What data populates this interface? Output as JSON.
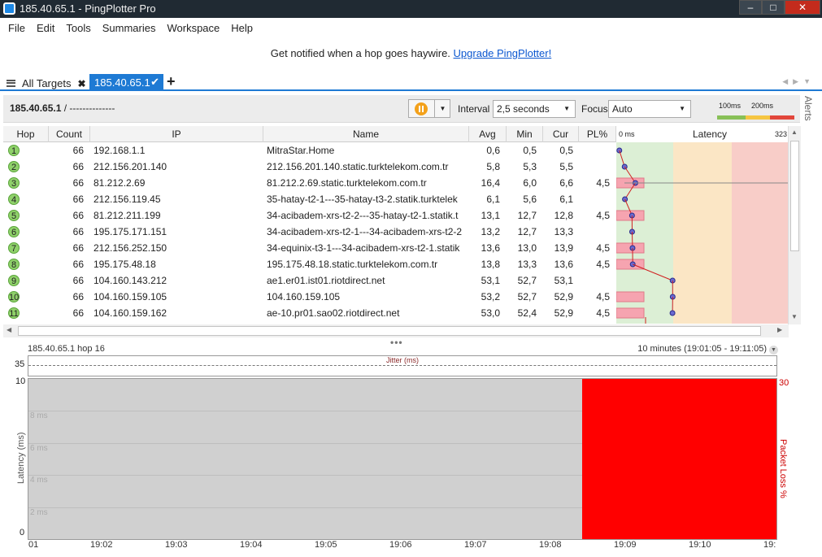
{
  "window": {
    "title": "185.40.65.1 - PingPlotter Pro"
  },
  "menu": [
    "File",
    "Edit",
    "Tools",
    "Summaries",
    "Workspace",
    "Help"
  ],
  "banner": {
    "text": "Get notified when a hop goes haywire.",
    "link": "Upgrade PingPlotter!"
  },
  "tabs": {
    "all": "All Targets",
    "active": "185.40.65.1"
  },
  "toolbar": {
    "target": "185.40.65.1",
    "target_suffix": "/ --------------",
    "interval_label": "Interval",
    "interval_value": "2,5 seconds",
    "focus_label": "Focus",
    "focus_value": "Auto",
    "legend": {
      "mark1": "100ms",
      "mark2": "200ms",
      "colors": [
        "#88c057",
        "#f5c542",
        "#e2463b"
      ]
    }
  },
  "alerts_label": "Alerts",
  "table": {
    "columns": [
      "Hop",
      "Count",
      "IP",
      "Name",
      "Avg",
      "Min",
      "Cur",
      "PL%",
      "0 ms",
      "Latency",
      "323"
    ],
    "rows": [
      {
        "hop": "1",
        "count": "66",
        "ip": "192.168.1.1",
        "name": "MitraStar.Home",
        "avg": "0,6",
        "min": "0,5",
        "cur": "0,5",
        "pl": ""
      },
      {
        "hop": "2",
        "count": "66",
        "ip": "212.156.201.140",
        "name": "212.156.201.140.static.turktelekom.com.tr",
        "avg": "5,8",
        "min": "5,3",
        "cur": "5,5",
        "pl": ""
      },
      {
        "hop": "3",
        "count": "66",
        "ip": "81.212.2.69",
        "name": "81.212.2.69.static.turktelekom.com.tr",
        "avg": "16,4",
        "min": "6,0",
        "cur": "6,6",
        "pl": "4,5"
      },
      {
        "hop": "4",
        "count": "66",
        "ip": "212.156.119.45",
        "name": "35-hatay-t2-1---35-hatay-t3-2.statik.turktelek",
        "avg": "6,1",
        "min": "5,6",
        "cur": "6,1",
        "pl": ""
      },
      {
        "hop": "5",
        "count": "66",
        "ip": "81.212.211.199",
        "name": "34-acibadem-xrs-t2-2---35-hatay-t2-1.statik.t",
        "avg": "13,1",
        "min": "12,7",
        "cur": "12,8",
        "pl": "4,5"
      },
      {
        "hop": "6",
        "count": "66",
        "ip": "195.175.171.151",
        "name": "34-acibadem-xrs-t2-1---34-acibadem-xrs-t2-2",
        "avg": "13,2",
        "min": "12,7",
        "cur": "13,3",
        "pl": ""
      },
      {
        "hop": "7",
        "count": "66",
        "ip": "212.156.252.150",
        "name": "34-equinix-t3-1---34-acibadem-xrs-t2-1.statik",
        "avg": "13,6",
        "min": "13,0",
        "cur": "13,9",
        "pl": "4,5"
      },
      {
        "hop": "8",
        "count": "66",
        "ip": "195.175.48.18",
        "name": "195.175.48.18.static.turktelekom.com.tr",
        "avg": "13,8",
        "min": "13,3",
        "cur": "13,6",
        "pl": "4,5"
      },
      {
        "hop": "9",
        "count": "66",
        "ip": "104.160.143.212",
        "name": "ae1.er01.ist01.riotdirect.net",
        "avg": "53,1",
        "min": "52,7",
        "cur": "53,1",
        "pl": ""
      },
      {
        "hop": "10",
        "count": "66",
        "ip": "104.160.159.105",
        "name": "104.160.159.105",
        "avg": "53,2",
        "min": "52,7",
        "cur": "52,9",
        "pl": "4,5"
      },
      {
        "hop": "11",
        "count": "66",
        "ip": "104.160.159.162",
        "name": "ae-10.pr01.sao02.riotdirect.net",
        "avg": "53,0",
        "min": "52,4",
        "cur": "52,9",
        "pl": "4,5"
      }
    ]
  },
  "graph": {
    "header": "185.40.65.1 hop 16",
    "range": "10 minutes (19:01:05 - 19:11:05)",
    "jitter_label": "Jitter (ms)",
    "jitter_max": "35",
    "y_top": "10",
    "y_bottom": "0",
    "y_right_top": "30",
    "grid_labels": [
      "8 ms",
      "6 ms",
      "4 ms",
      "2 ms"
    ],
    "ylabel": "Latency (ms)",
    "y2label": "Packet Loss %",
    "x_ticks": [
      "01",
      "19:02",
      "19:03",
      "19:04",
      "19:05",
      "19:06",
      "19:07",
      "19:08",
      "19:09",
      "19:10",
      "19:"
    ],
    "loss_start_fraction": 0.74
  }
}
